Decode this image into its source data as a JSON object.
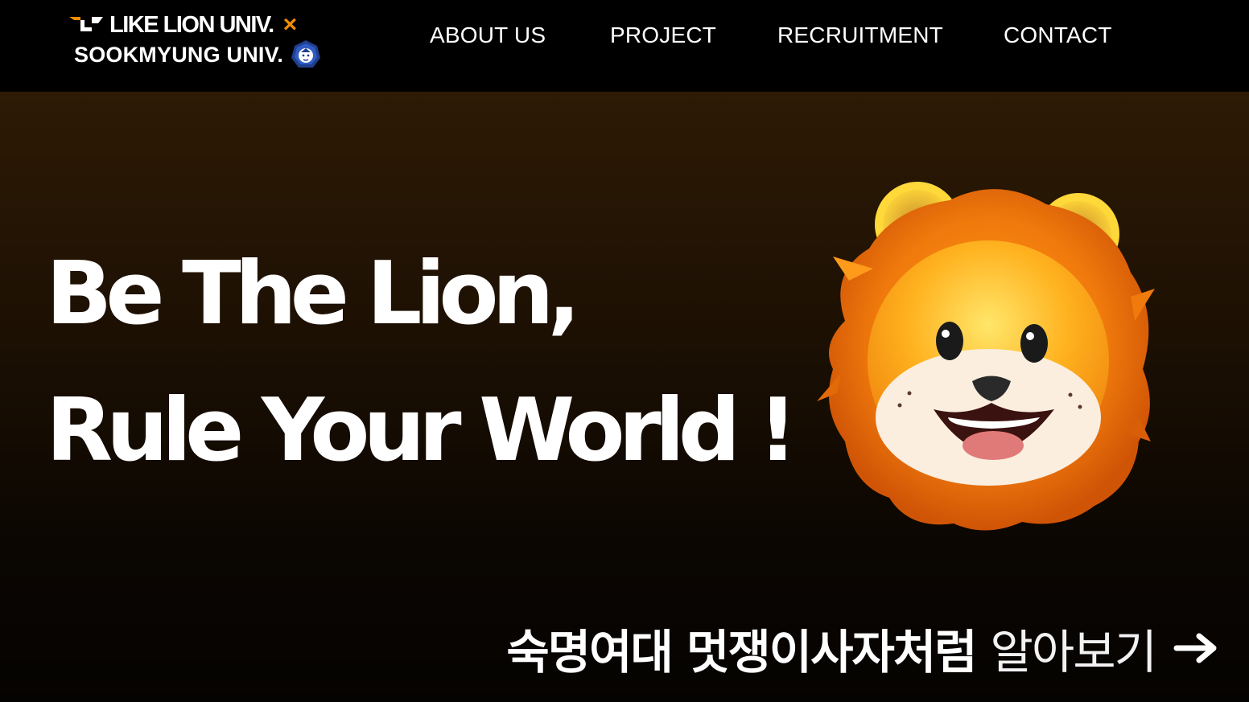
{
  "header": {
    "logo": {
      "line1": "LIKE LION UNIV.",
      "separator": "×",
      "line2": "SOOKMYUNG UNIV.",
      "mark_icon": "likelion-mark-icon",
      "emblem_icon": "sookmyung-emblem-icon"
    },
    "nav": [
      {
        "label": "ABOUT US"
      },
      {
        "label": "PROJECT"
      },
      {
        "label": "RECRUITMENT"
      },
      {
        "label": "CONTACT"
      }
    ]
  },
  "hero": {
    "headline_line1": "Be The Lion,",
    "headline_line2": "Rule Your World !",
    "illustration": "lion-mascot-icon",
    "cta": {
      "bold_text": "숙명여대 멋쟁이사자처럼",
      "light_text": "알아보기",
      "icon": "arrow-right-icon"
    }
  },
  "colors": {
    "accent": "#f28c00",
    "header_bg": "#000000",
    "hero_bg_top": "#2e1a05",
    "hero_bg_bottom": "#050301",
    "text": "#ffffff"
  }
}
